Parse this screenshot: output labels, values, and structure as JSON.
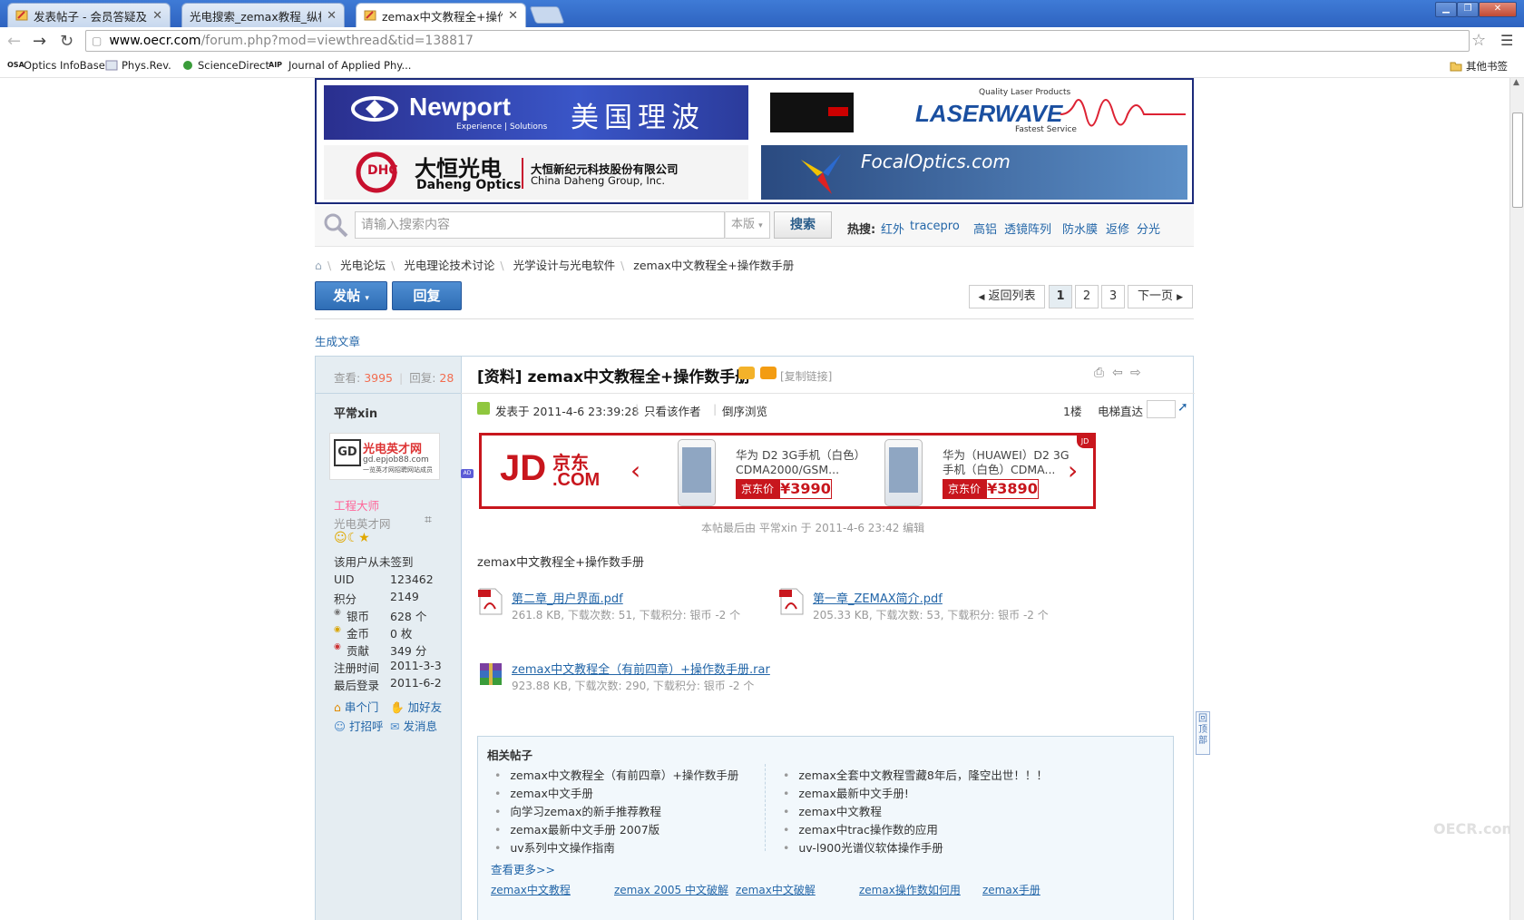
{
  "browser": {
    "tabs": [
      {
        "title": "发表帖子 - 会员答疑及建议",
        "active": false
      },
      {
        "title": "光电搜索_zemax教程_纵横光电",
        "active": false
      },
      {
        "title": "zemax中文教程全+操作数手册",
        "active": true
      }
    ],
    "url_host": "www.oecr.com",
    "url_path": "/forum.php?mod=viewthread&tid=138817",
    "bookmarks": [
      "Optics InfoBase",
      "Phys.Rev.",
      "ScienceDirect",
      "Journal of Applied Phy..."
    ],
    "bookmark_icons": [
      "OSA",
      "AIP"
    ],
    "other_bookmarks": "其他书签"
  },
  "ads": {
    "newport": {
      "brand": "Newport",
      "tagline": "Experience | Solutions",
      "cn": "美国理波"
    },
    "laserwave": {
      "top": "Quality Laser Products",
      "brand": "LASERWAVE",
      "bottom": "Fastest Service"
    },
    "daheng": {
      "logo": "DHC",
      "cn_brand": "大恒光电",
      "en_brand": "Daheng Optics",
      "company_cn": "大恒新纪元科技股份有限公司",
      "company_en": "China Daheng Group,  Inc."
    },
    "focal": {
      "brand": "FocalOptics.com"
    }
  },
  "search": {
    "placeholder": "请输入搜索内容",
    "scope": "本版",
    "button": "搜索",
    "hot_label": "热搜:",
    "hot_words": [
      "红外",
      "tracepro",
      "高铝",
      "透镜阵列",
      "防水膜",
      "返修",
      "分光"
    ]
  },
  "breadcrumb": [
    "光电论坛",
    "光电理论技术讨论",
    "光学设计与光电软件",
    "zemax中文教程全+操作数手册"
  ],
  "actions": {
    "post": "发帖",
    "reply": "回复"
  },
  "pagination": {
    "back": "返回列表",
    "pages": [
      "1",
      "2",
      "3"
    ],
    "current": "1",
    "next": "下一页"
  },
  "gen_article": "生成文章",
  "thread": {
    "views_label": "查看:",
    "views": "3995",
    "replies_label": "回复:",
    "replies": "28",
    "title": "[资料] zemax中文教程全+操作数手册",
    "copy_link": "[复制链接]"
  },
  "author": {
    "name": "平常xin",
    "avatar_logo": "GD",
    "avatar_title": "光电英才网",
    "avatar_url": "gd.epjob88.com",
    "avatar_slogan": "一览英才网招聘网站成员",
    "rank": "工程大师",
    "group": "光电英才网",
    "checkin": "该用户从未签到",
    "stats": [
      {
        "label": "UID",
        "value": "123462"
      },
      {
        "label": "积分",
        "value": "2149"
      },
      {
        "label": "银币",
        "value": "628 个"
      },
      {
        "label": "金币",
        "value": "0 枚"
      },
      {
        "label": "贡献",
        "value": "349 分"
      },
      {
        "label": "注册时间",
        "value": "2011-3-3"
      },
      {
        "label": "最后登录",
        "value": "2011-6-2"
      }
    ],
    "links": [
      "串个门",
      "加好友",
      "打招呼",
      "发消息"
    ]
  },
  "post": {
    "posted_at": "发表于 2011-4-6 23:39:28",
    "only_author": "只看该作者",
    "reverse": "倒序浏览",
    "floor": "1楼",
    "elevator": "电梯直达",
    "edit_note": "本帖最后由 平常xin 于 2011-4-6 23:42 编辑",
    "body": "zemax中文教程全+操作数手册",
    "attachments": [
      {
        "name": "第二章_用户界面.pdf",
        "meta": "261.8 KB, 下载次数: 51, 下载积分: 银币 -2 个",
        "type": "pdf"
      },
      {
        "name": "第一章_ZEMAX简介.pdf",
        "meta": "205.33 KB, 下载次数: 53, 下载积分: 银币 -2 个",
        "type": "pdf"
      },
      {
        "name": "zemax中文教程全（有前四章）+操作数手册.rar",
        "meta": "923.88 KB, 下载次数: 290, 下载积分: 银币 -2 个",
        "type": "rar"
      }
    ]
  },
  "jd_ad": {
    "badge": "AD",
    "logo_a": "JD",
    "logo_b": "京东",
    "logo_c": ".COM",
    "corner": "JD",
    "price_label": "京东价",
    "products": [
      {
        "name": "华为 D2 3G手机（白色）CDMA2000/GSM...",
        "price": "¥3990"
      },
      {
        "name": "华为（HUAWEI）D2 3G手机（白色）CDMA...",
        "price": "¥3890"
      }
    ]
  },
  "related": {
    "title": "相关帖子",
    "left": [
      "zemax中文教程全（有前四章）+操作数手册",
      "zemax中文手册",
      "向学习zemax的新手推荐教程",
      "zemax最新中文手册 2007版",
      "uv系列中文操作指南"
    ],
    "right": [
      "zemax全套中文教程雪藏8年后，隆空出世！！！",
      "zemax最新中文手册!",
      "zemax中文教程",
      "zemax中trac操作数的应用",
      "uv-l900光谱仪软体操作手册"
    ],
    "more": "查看更多>>",
    "tags": [
      "zemax中文教程",
      "zemax 2005 中文破解",
      "zemax中文破解",
      "zemax操作数如何用",
      "zemax手册"
    ]
  },
  "back_to_top": "回顶部",
  "watermark": "OECR.com"
}
